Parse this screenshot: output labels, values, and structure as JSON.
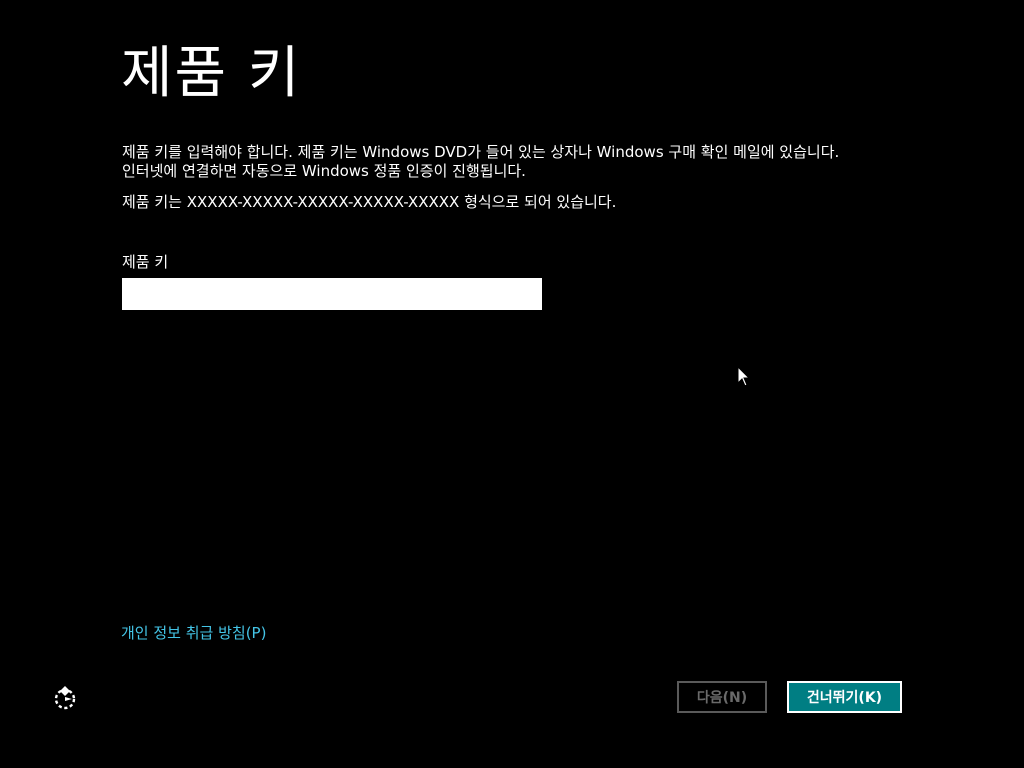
{
  "page": {
    "title": "제품 키",
    "description_line1": "제품 키를 입력해야 합니다. 제품 키는 Windows DVD가 들어 있는 상자나 Windows 구매 확인 메일에 있습니다.",
    "description_line2": "인터넷에 연결하면 자동으로 Windows 정품 인증이 진행됩니다.",
    "format_hint": "제품 키는 XXXXX-XXXXX-XXXXX-XXXXX-XXXXX 형식으로 되어 있습니다."
  },
  "product_key_field": {
    "label": "제품 키",
    "value": "",
    "placeholder": ""
  },
  "footer": {
    "privacy_link": "개인 정보 취급 방침(P)",
    "ease_of_access_icon": "ease-of-access-icon",
    "next_button": "다음(N)",
    "skip_button": "건너뛰기(K)"
  },
  "colors": {
    "background": "#000000",
    "text": "#ffffff",
    "link": "#44c4e6",
    "skip_button_bg": "#007e83",
    "disabled_button_border": "#5a5a5a",
    "disabled_button_text": "#6a6a6a"
  }
}
